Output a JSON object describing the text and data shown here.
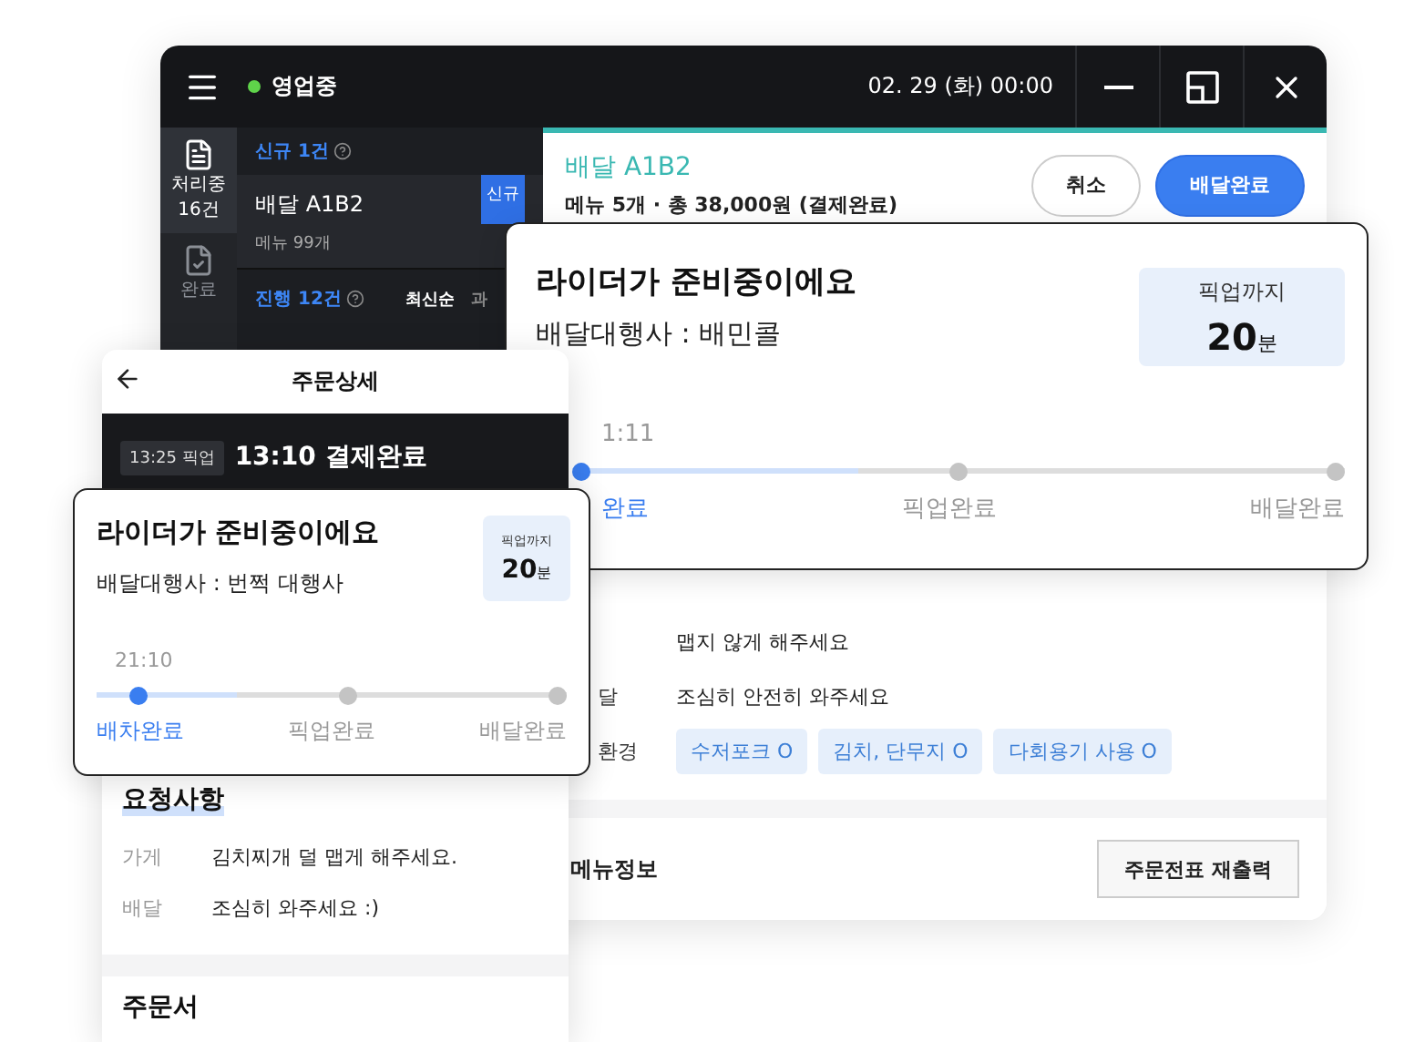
{
  "desktop": {
    "menu_open": false,
    "status": {
      "label": "영업중",
      "on": true
    },
    "datetime": "02. 29 (화) 00:00",
    "rail": [
      {
        "label": "처리중",
        "count": "16건",
        "kind": "list",
        "selected": true
      },
      {
        "label": "완료",
        "kind": "done",
        "selected": false
      }
    ],
    "new_section": {
      "title": "신규 1건"
    },
    "order": {
      "title": "배달 A1B2",
      "menu": "메뉴 99개",
      "badge": "신규"
    },
    "progress_section": {
      "title": "진행 12건",
      "sort": [
        {
          "label": "최신순",
          "selected": true
        },
        {
          "label": "과",
          "selected": false
        }
      ]
    },
    "detail": {
      "title": "배달 A1B2",
      "summary": "메뉴 5개 · 총 38,000원 (결제완료)",
      "buttons": [
        {
          "label": "취소",
          "kind": "secondary"
        },
        {
          "label": "배달완료",
          "kind": "primary"
        }
      ]
    },
    "requests": [
      {
        "value": "맵지 않게 해주세요"
      },
      {
        "label": "달",
        "value": "조심히 안전히 와주세요"
      },
      {
        "label": "환경",
        "chips": [
          "수저포크 O",
          "김치, 단무지 O",
          "다회용기 사용 O"
        ]
      }
    ],
    "menu_section": {
      "title": "메뉴정보",
      "button": "주문전표 재출력"
    }
  },
  "rider_card_large": {
    "title": "라이더가 준비중이에요",
    "agency": "배달대행사 : 배민콜",
    "pickup": {
      "label": "픽업까지",
      "value": "20",
      "unit": "분"
    },
    "time": "1:11",
    "level": 0.37,
    "steps": [
      {
        "label": "완료",
        "done": true
      },
      {
        "label": "픽업완료",
        "done": false
      },
      {
        "label": "배달완료",
        "done": false
      }
    ]
  },
  "mobile": {
    "title": "주문상세",
    "pickup_tag": "13:25 픽업",
    "status": "13:10 결제완료",
    "requests": {
      "title": "요청사항",
      "rows": [
        {
          "label": "가게",
          "value": "김치찌개 덜 맵게 해주세요."
        },
        {
          "label": "배달",
          "value": "조심히 와주세요 :)"
        }
      ]
    },
    "next_section": "주문서"
  },
  "rider_card_small": {
    "title": "라이더가 준비중이에요",
    "agency": "배달대행사 : 번쩍 대행사",
    "pickup": {
      "label": "픽업까지",
      "value": "20",
      "unit": "분"
    },
    "time": "21:10",
    "level": 0.3,
    "steps": [
      {
        "label": "배차완료",
        "done": true
      },
      {
        "label": "픽업완료",
        "done": false
      },
      {
        "label": "배달완료",
        "done": false
      }
    ]
  }
}
